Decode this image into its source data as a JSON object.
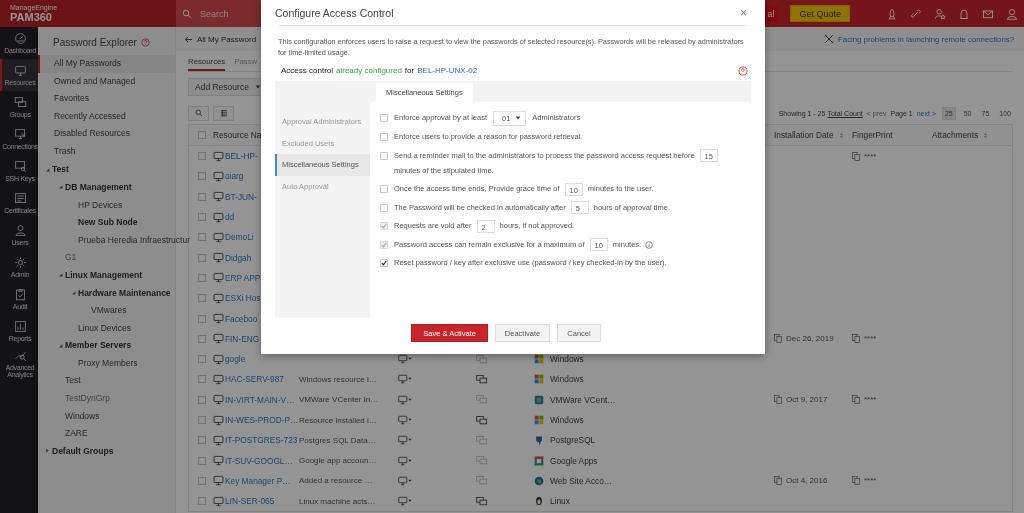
{
  "topbar": {
    "brand": "ManageEngine",
    "product": "PAM360",
    "search": {
      "placeholder": "Search"
    },
    "partial_button": "al",
    "quote_button": "Get Quote"
  },
  "nav": [
    {
      "label": "Dashboard",
      "selected": false
    },
    {
      "label": "Resources",
      "selected": true
    },
    {
      "label": "Groups",
      "selected": false
    },
    {
      "label": "Connections",
      "selected": false
    },
    {
      "label": "SSH Keys",
      "selected": false
    },
    {
      "label": "Certificates",
      "selected": false
    },
    {
      "label": "Users",
      "selected": false
    },
    {
      "label": "Admin",
      "selected": false
    },
    {
      "label": "Audit",
      "selected": false
    },
    {
      "label": "Reports",
      "selected": false
    },
    {
      "label": "Advanced Analytics",
      "selected": false
    }
  ],
  "sidebar": {
    "title": "Password Explorer",
    "quick_links": [
      {
        "label": "All My Passwords",
        "selected": true
      },
      {
        "label": "Owned and Managed",
        "selected": false
      },
      {
        "label": "Favorites",
        "selected": false
      },
      {
        "label": "Recently Accessed",
        "selected": false
      },
      {
        "label": "Disabled Resources",
        "selected": false
      },
      {
        "label": "Trash",
        "selected": false
      }
    ],
    "tree": [
      {
        "label": "Test",
        "bold": true,
        "disabled": false,
        "expanded": true,
        "children": [
          {
            "label": "DB Management",
            "bold": true,
            "disabled": false,
            "expanded": true,
            "children": [
              {
                "label": "HP Devices",
                "bold": false,
                "disabled": false
              },
              {
                "label": "New Sub Node",
                "bold": true,
                "disabled": false
              },
              {
                "label": "Prueba Heredia Infraestructur",
                "bold": false,
                "disabled": false
              }
            ]
          },
          {
            "label": "G1",
            "bold": false,
            "disabled": true
          },
          {
            "label": "Linux Management",
            "bold": true,
            "disabled": false,
            "expanded": true,
            "children": [
              {
                "label": "Hardware Maintenance",
                "bold": true,
                "disabled": false,
                "expanded": true,
                "children": [
                  {
                    "label": "VMwares",
                    "bold": false,
                    "disabled": false
                  }
                ]
              },
              {
                "label": "Linux Devices",
                "bold": false,
                "disabled": false
              }
            ]
          },
          {
            "label": "Member Servers",
            "bold": true,
            "disabled": false,
            "expanded": true,
            "children": [
              {
                "label": "Proxy Members",
                "bold": false,
                "disabled": false
              }
            ]
          },
          {
            "label": "Test",
            "bold": false,
            "disabled": false
          },
          {
            "label": "TestDynGrp",
            "bold": false,
            "disabled": true
          },
          {
            "label": "Windows",
            "bold": false,
            "disabled": false
          },
          {
            "label": "ZARE",
            "bold": false,
            "disabled": false
          }
        ]
      },
      {
        "label": "Default Groups",
        "bold": true,
        "disabled": false,
        "expanded": false
      }
    ]
  },
  "page": {
    "breadcrumb": "All My Password",
    "help_link": "Facing problems in launching remote connections?",
    "tabs": [
      {
        "label": "Resources",
        "selected": true
      },
      {
        "label": "Passw",
        "selected": false
      }
    ],
    "add_button": "Add Resource",
    "pagination": {
      "showing": "Showing 1 - 25",
      "total": "Total Count",
      "prev": "< prev",
      "page": "Page 1",
      "next": "next >",
      "sizes": [
        {
          "label": "25",
          "selected": true
        },
        {
          "label": "50",
          "selected": false
        },
        {
          "label": "75",
          "selected": false
        },
        {
          "label": "100",
          "selected": false
        }
      ]
    }
  },
  "table": {
    "columns": [
      "Resource Na",
      "Installation Date",
      "FingerPrint",
      "Attachments"
    ],
    "all_checked": false,
    "rows": [
      {
        "checked": false,
        "name": "BEL-HP-",
        "fingerprint": "****"
      },
      {
        "checked": false,
        "name": "oiarg"
      },
      {
        "checked": false,
        "name": "BT-JUN-"
      },
      {
        "checked": false,
        "name": "dd"
      },
      {
        "checked": false,
        "name": "DemoLi"
      },
      {
        "checked": false,
        "name": "Didgah"
      },
      {
        "checked": false,
        "name": "ERP APP"
      },
      {
        "checked": false,
        "name": "ESXi Hos"
      },
      {
        "checked": false,
        "name": "Faceboo"
      },
      {
        "checked": false,
        "name": "FIN-ENG",
        "date": "Dec 26, 2019",
        "fingerprint": "****"
      },
      {
        "checked": false,
        "name": "gogle",
        "remote_active": false,
        "os": "Windows",
        "kind": "windows"
      },
      {
        "checked": false,
        "name": "HAC-SERV-987",
        "description": "Windows resource i…",
        "remote_active": true,
        "os": "Windows",
        "kind": "windows"
      },
      {
        "checked": false,
        "name": "IN-VIRT-MAIN-V…",
        "description": "VMWare VCenter In…",
        "remote_active": false,
        "os": "VMWare VCent…",
        "kind": "vmware",
        "date": "Oct 9, 2017",
        "fingerprint": "****"
      },
      {
        "checked": false,
        "name": "IN-WES-PROD-P…",
        "description": "Resource installed i…",
        "remote_active": true,
        "os": "Windows",
        "kind": "windows"
      },
      {
        "checked": false,
        "name": "IT-POSTGRES-723",
        "description": "Postgres SQL Data…",
        "remote_active": false,
        "os": "PostgreSQL",
        "kind": "postgres"
      },
      {
        "checked": false,
        "name": "IT-SUV-GOOGL…",
        "description": "Google app accoun…",
        "remote_active": false,
        "os": "Google Apps",
        "kind": "google"
      },
      {
        "checked": false,
        "name": "Key Manager P…",
        "description": "Added a resource …",
        "remote_active": false,
        "os": "Web Site Acco…",
        "kind": "web",
        "date": "Oct 4, 2016",
        "fingerprint": "****"
      },
      {
        "checked": false,
        "name": "LIN-SER-065",
        "description": "Linux machine acts…",
        "remote_active": true,
        "os": "Linux",
        "kind": "linux"
      }
    ]
  },
  "dialog": {
    "title": "Configure Access Control",
    "close": "×",
    "description": "This configuration enforces users to raise a request to view the passwords of selected resource(s). Passwords will be released by administrators for time-limited usage.",
    "status": {
      "prefix": "Access control",
      "state": "already configured",
      "middle": "for",
      "resource": "BEL-HP-UNX-02"
    },
    "side_tabs": [
      {
        "label": "Approval Administrators",
        "selected": false
      },
      {
        "label": "Excluded Users",
        "selected": false
      },
      {
        "label": "Miscellaneous Settings",
        "selected": true
      },
      {
        "label": "Auto Approval",
        "selected": false
      }
    ],
    "panel_tab": "Miscellaneous Settings",
    "options": [
      {
        "checked": false,
        "disabled": false,
        "parts": [
          {
            "kind": "text",
            "text": "Enforce approval by at least"
          },
          {
            "kind": "select",
            "text": "01"
          },
          {
            "kind": "text",
            "text": "Administrators"
          }
        ]
      },
      {
        "checked": false,
        "disabled": false,
        "parts": [
          {
            "kind": "text",
            "text": "Enforce users to provide a reason for password retrieval."
          }
        ]
      },
      {
        "checked": false,
        "disabled": false,
        "parts": [
          {
            "kind": "text",
            "text": "Send a reminder mail to the administrators to process the password access request before"
          },
          {
            "kind": "input",
            "text": "15"
          },
          {
            "kind": "text",
            "text": "minutes of the stipulated time."
          }
        ]
      },
      {
        "checked": false,
        "disabled": false,
        "parts": [
          {
            "kind": "text",
            "text": "Once the access time ends, Provide grace time of"
          },
          {
            "kind": "input",
            "text": "10"
          },
          {
            "kind": "text",
            "text": "minutes to the user."
          }
        ]
      },
      {
        "checked": false,
        "disabled": false,
        "parts": [
          {
            "kind": "text",
            "text": "The Password will be checked in automatically after"
          },
          {
            "kind": "input",
            "text": "5"
          },
          {
            "kind": "text",
            "text": "hours of approval time."
          }
        ]
      },
      {
        "checked": true,
        "disabled": true,
        "parts": [
          {
            "kind": "text",
            "text": "Requests are void after"
          },
          {
            "kind": "input",
            "text": "2"
          },
          {
            "kind": "text",
            "text": "hours, if not approved."
          }
        ]
      },
      {
        "checked": true,
        "disabled": true,
        "parts": [
          {
            "kind": "text",
            "text": "Password access can remain exclusive for a maximum of"
          },
          {
            "kind": "input",
            "text": "10"
          },
          {
            "kind": "text",
            "text": "minutes."
          },
          {
            "kind": "info"
          }
        ]
      },
      {
        "checked": true,
        "disabled": false,
        "parts": [
          {
            "kind": "text",
            "text": "Reset password / key after exclusive use (password / key checked-in by the user)."
          }
        ]
      }
    ],
    "buttons": [
      {
        "label": "Save & Activate",
        "kind": "primary"
      },
      {
        "label": "Deactivate",
        "kind": "default"
      },
      {
        "label": "Cancel",
        "kind": "default"
      }
    ]
  }
}
